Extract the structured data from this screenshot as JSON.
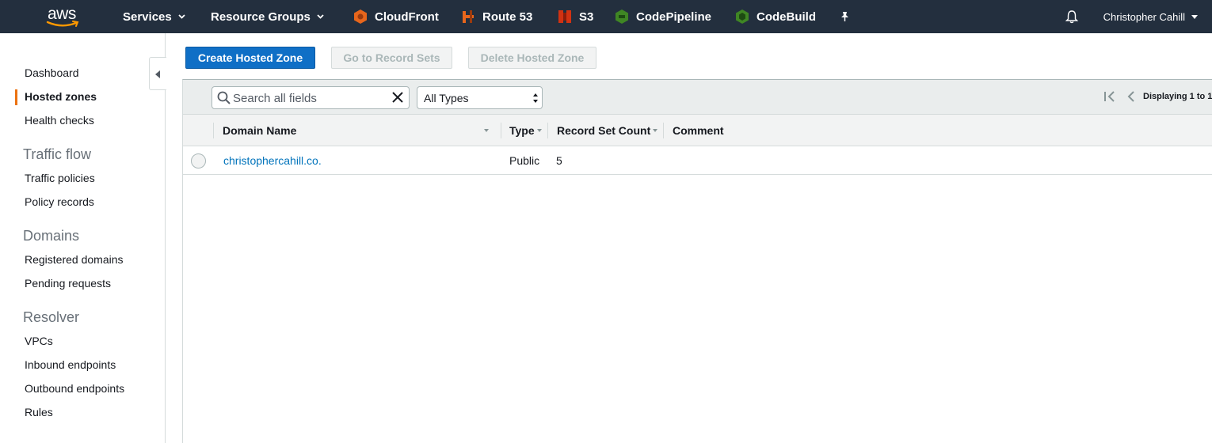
{
  "topnav": {
    "logo_text": "aws",
    "services": "Services",
    "resource_groups": "Resource Groups",
    "shortcuts": [
      {
        "label": "CloudFront",
        "icon": "cloudfront-icon",
        "color": "#e7661c"
      },
      {
        "label": "Route 53",
        "icon": "route53-icon",
        "color": "#e7661c"
      },
      {
        "label": "S3",
        "icon": "s3-icon",
        "color": "#d13212"
      },
      {
        "label": "CodePipeline",
        "icon": "codepipeline-icon",
        "color": "#3f8624"
      },
      {
        "label": "CodeBuild",
        "icon": "codebuild-icon",
        "color": "#3f8624"
      }
    ],
    "user": "Christopher Cahill"
  },
  "sidebar": {
    "items": [
      {
        "label": "Dashboard"
      },
      {
        "label": "Hosted zones",
        "active": true
      },
      {
        "label": "Health checks"
      }
    ],
    "sections": [
      {
        "title": "Traffic flow",
        "items": [
          "Traffic policies",
          "Policy records"
        ]
      },
      {
        "title": "Domains",
        "items": [
          "Registered domains",
          "Pending requests"
        ]
      },
      {
        "title": "Resolver",
        "items": [
          "VPCs",
          "Inbound endpoints",
          "Outbound endpoints",
          "Rules"
        ]
      }
    ]
  },
  "toolbar": {
    "create": "Create Hosted Zone",
    "goto": "Go to Record Sets",
    "delete": "Delete Hosted Zone"
  },
  "filter": {
    "search_placeholder": "Search all fields",
    "type_select": "All Types",
    "paging": "Displaying 1 to 1"
  },
  "table": {
    "columns": [
      "Domain Name",
      "Type",
      "Record Set Count",
      "Comment"
    ],
    "rows": [
      {
        "domain": "christophercahill.co.",
        "type": "Public",
        "count": "5",
        "comment": ""
      }
    ]
  },
  "colors": {
    "accent": "#ec7211",
    "primary": "#0f6fc6",
    "nav_bg": "#232f3e",
    "link": "#0073bb"
  }
}
